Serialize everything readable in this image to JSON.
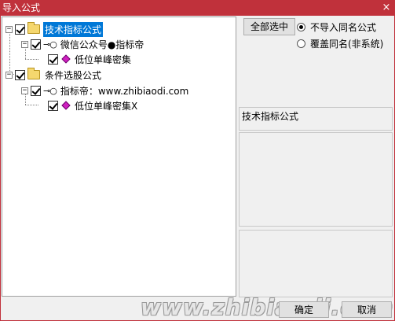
{
  "window": {
    "title": "导入公式",
    "close_glyph": "×"
  },
  "tree": {
    "items": [
      {
        "label": "技术指标公式",
        "level": 0,
        "expander": "−",
        "icon": "folder-icon",
        "checked": true,
        "selected": true
      },
      {
        "label": "微信公众号●指标帝",
        "level": 1,
        "expander": "−",
        "icon": "key-icon",
        "checked": true
      },
      {
        "label": "低位单峰密集",
        "level": 2,
        "icon": "gem-icon",
        "checked": true
      },
      {
        "label": "条件选股公式",
        "level": 0,
        "expander": "−",
        "icon": "folder-icon",
        "checked": true
      },
      {
        "label": "指标帝：www.zhibiaodi.com",
        "level": 1,
        "expander": "−",
        "icon": "key-icon",
        "checked": true
      },
      {
        "label": "低位单峰密集X",
        "level": 2,
        "icon": "gem-icon",
        "checked": true
      }
    ],
    "key_glyph": "⊸○"
  },
  "right": {
    "select_all_label": "全部选中",
    "radio_options": [
      {
        "label": "不导入同名公式",
        "checked": true
      },
      {
        "label": "覆盖同名(非系统)",
        "checked": false
      }
    ],
    "group_title": "技术指标公式"
  },
  "footer": {
    "ok_label": "确定",
    "cancel_label": "取消",
    "watermark": "www.zhibiaodi.com"
  }
}
